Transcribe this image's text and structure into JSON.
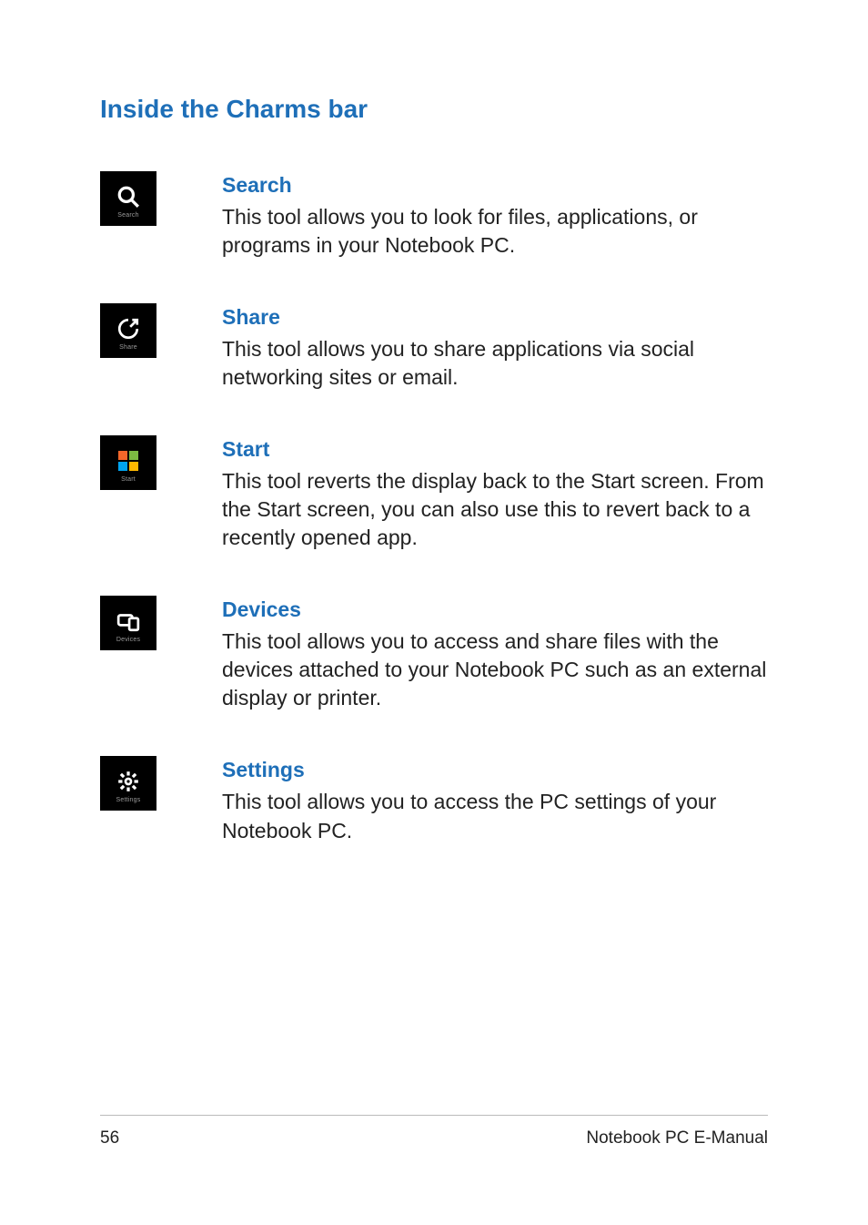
{
  "heading": "Inside the Charms bar",
  "charms": [
    {
      "tile_label": "Search",
      "title": "Search",
      "desc": "This tool allows you to look for files, applications, or programs in your Notebook PC."
    },
    {
      "tile_label": "Share",
      "title": "Share",
      "desc": "This tool allows you to share applications via social networking sites or email."
    },
    {
      "tile_label": "Start",
      "title": "Start",
      "desc": "This tool reverts the display back to the Start screen. From the Start screen, you can also use this to revert back to a recently opened app."
    },
    {
      "tile_label": "Devices",
      "title": "Devices",
      "desc": "This tool allows you to access and share files with the devices attached to your Notebook PC such as an external display or printer."
    },
    {
      "tile_label": "Settings",
      "title": "Settings",
      "desc": "This tool allows you to access the PC settings of your Notebook PC."
    }
  ],
  "footer": {
    "page": "56",
    "title": "Notebook PC E-Manual"
  }
}
